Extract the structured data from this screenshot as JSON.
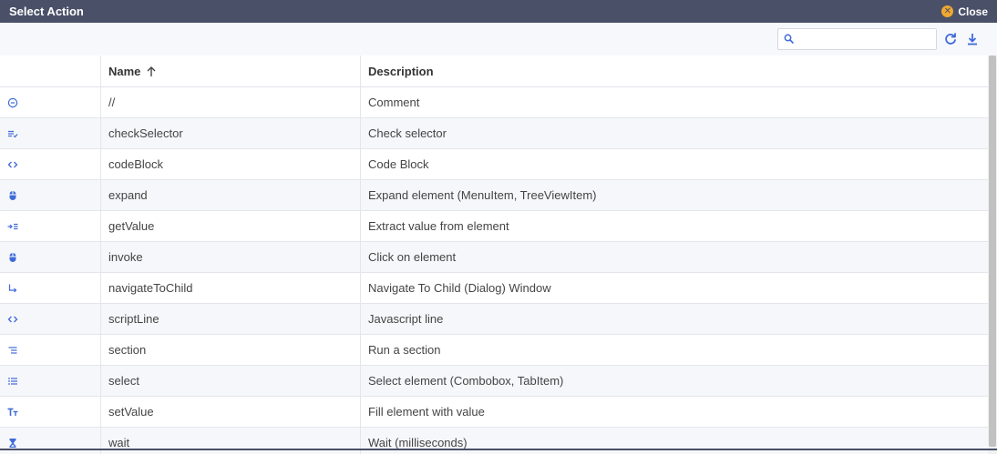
{
  "window": {
    "title": "Select Action",
    "close_label": "Close"
  },
  "toolbar": {
    "search_placeholder": "",
    "search_value": ""
  },
  "colors": {
    "titlebar": "#4a5068",
    "accent": "#3f6ad8",
    "close_icon": "#f0a830",
    "row_alt": "#f6f7fa"
  },
  "columns": {
    "icon": "",
    "name": "Name",
    "description": "Description",
    "sort": "ascending"
  },
  "rows": [
    {
      "icon": "comment-icon",
      "name": "//",
      "description": "Comment"
    },
    {
      "icon": "check-list-icon",
      "name": "checkSelector",
      "description": "Check selector"
    },
    {
      "icon": "code-icon",
      "name": "codeBlock",
      "description": "Code Block"
    },
    {
      "icon": "mouse-icon",
      "name": "expand",
      "description": "Expand element (MenuItem, TreeViewItem)"
    },
    {
      "icon": "extract-icon",
      "name": "getValue",
      "description": "Extract value from element"
    },
    {
      "icon": "mouse-icon",
      "name": "invoke",
      "description": "Click on element"
    },
    {
      "icon": "subdirectory-arrow-icon",
      "name": "navigateToChild",
      "description": "Navigate To Child (Dialog) Window"
    },
    {
      "icon": "code-icon",
      "name": "scriptLine",
      "description": "Javascript line"
    },
    {
      "icon": "section-list-icon",
      "name": "section",
      "description": "Run a section"
    },
    {
      "icon": "bullet-list-icon",
      "name": "select",
      "description": "Select element (Combobox, TabItem)"
    },
    {
      "icon": "text-size-icon",
      "name": "setValue",
      "description": "Fill element with value"
    },
    {
      "icon": "hourglass-icon",
      "name": "wait",
      "description": "Wait (milliseconds)"
    }
  ]
}
